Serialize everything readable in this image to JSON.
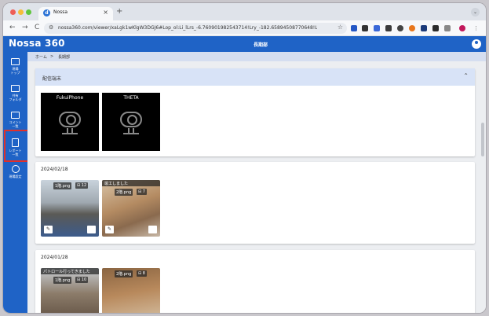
{
  "browser": {
    "tab_title": "Nossa",
    "favicon_letter": "d",
    "close_tab": "×",
    "new_tab": "+",
    "url": "nossa360.com/viewer/xaLgk1wKlgW3DGJ6#Lop_ol:Li_lLrs_-6.760901982543714!Lry_-182.65894508770648!LpA_tLpB_tLp...",
    "nav_back": "←",
    "nav_forward": "→",
    "reload": "C",
    "tab_menu": "⌄"
  },
  "app": {
    "logo": "Nossa 360",
    "page_heading": "長期部"
  },
  "sidebar": {
    "items": [
      {
        "label1": "現場",
        "label2": "トップ"
      },
      {
        "label1": "共有",
        "label2": "フォルダ"
      },
      {
        "label1": "コメント",
        "label2": "一覧"
      },
      {
        "label1": "レポート",
        "label2": "一覧"
      },
      {
        "label1": "現場設定",
        "label2": ""
      }
    ]
  },
  "breadcrumb": {
    "home": "ホーム",
    "sep": ">",
    "current": "長期部"
  },
  "devices_card": {
    "title": "配信端末",
    "devices": [
      "FukuiPhone",
      "THETA"
    ]
  },
  "groups": [
    {
      "date": "2024/02/18",
      "photos": [
        {
          "caption": "",
          "file": "1階.png",
          "count": "12"
        },
        {
          "caption": "竣工しました",
          "file": "2階.png",
          "count": "7"
        }
      ]
    },
    {
      "date": "2024/01/28",
      "photos": [
        {
          "caption": "パトロール行ってきました",
          "file": "1階.png",
          "count": "10"
        },
        {
          "caption": "",
          "file": "2階.png",
          "count": "8"
        }
      ]
    }
  ],
  "colors": {
    "brand": "#1f63c6",
    "highlight": "#e0302a"
  }
}
